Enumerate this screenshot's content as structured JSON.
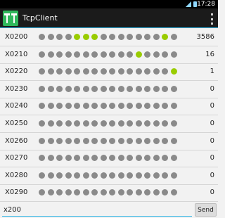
{
  "status_bar": {
    "time": "17:28",
    "icons": [
      "wifi-icon",
      "battery-icon"
    ]
  },
  "action_bar": {
    "title": "TcpClient",
    "app_icon": "tcp-client-app-icon",
    "menu_icon": "overflow-menu-icon"
  },
  "colors": {
    "dot_off": "#8a8a8a",
    "dot_on": "#99cc00",
    "accent": "#33b5e5"
  },
  "rows": [
    {
      "addr": "X0200",
      "value": "3586",
      "bits": [
        0,
        0,
        0,
        0,
        1,
        1,
        1,
        0,
        0,
        0,
        0,
        0,
        0,
        0,
        1,
        0
      ]
    },
    {
      "addr": "X0210",
      "value": "16",
      "bits": [
        0,
        0,
        0,
        0,
        0,
        0,
        0,
        0,
        0,
        0,
        0,
        1,
        0,
        0,
        0,
        0
      ]
    },
    {
      "addr": "X0220",
      "value": "1",
      "bits": [
        0,
        0,
        0,
        0,
        0,
        0,
        0,
        0,
        0,
        0,
        0,
        0,
        0,
        0,
        0,
        1
      ]
    },
    {
      "addr": "X0230",
      "value": "0",
      "bits": [
        0,
        0,
        0,
        0,
        0,
        0,
        0,
        0,
        0,
        0,
        0,
        0,
        0,
        0,
        0,
        0
      ]
    },
    {
      "addr": "X0240",
      "value": "0",
      "bits": [
        0,
        0,
        0,
        0,
        0,
        0,
        0,
        0,
        0,
        0,
        0,
        0,
        0,
        0,
        0,
        0
      ]
    },
    {
      "addr": "X0250",
      "value": "0",
      "bits": [
        0,
        0,
        0,
        0,
        0,
        0,
        0,
        0,
        0,
        0,
        0,
        0,
        0,
        0,
        0,
        0
      ]
    },
    {
      "addr": "X0260",
      "value": "0",
      "bits": [
        0,
        0,
        0,
        0,
        0,
        0,
        0,
        0,
        0,
        0,
        0,
        0,
        0,
        0,
        0,
        0
      ]
    },
    {
      "addr": "X0270",
      "value": "0",
      "bits": [
        0,
        0,
        0,
        0,
        0,
        0,
        0,
        0,
        0,
        0,
        0,
        0,
        0,
        0,
        0,
        0
      ]
    },
    {
      "addr": "X0280",
      "value": "0",
      "bits": [
        0,
        0,
        0,
        0,
        0,
        0,
        0,
        0,
        0,
        0,
        0,
        0,
        0,
        0,
        0,
        0
      ]
    },
    {
      "addr": "X0290",
      "value": "0",
      "bits": [
        0,
        0,
        0,
        0,
        0,
        0,
        0,
        0,
        0,
        0,
        0,
        0,
        0,
        0,
        0,
        0
      ]
    }
  ],
  "input": {
    "value": "x200",
    "send_label": "Send"
  }
}
